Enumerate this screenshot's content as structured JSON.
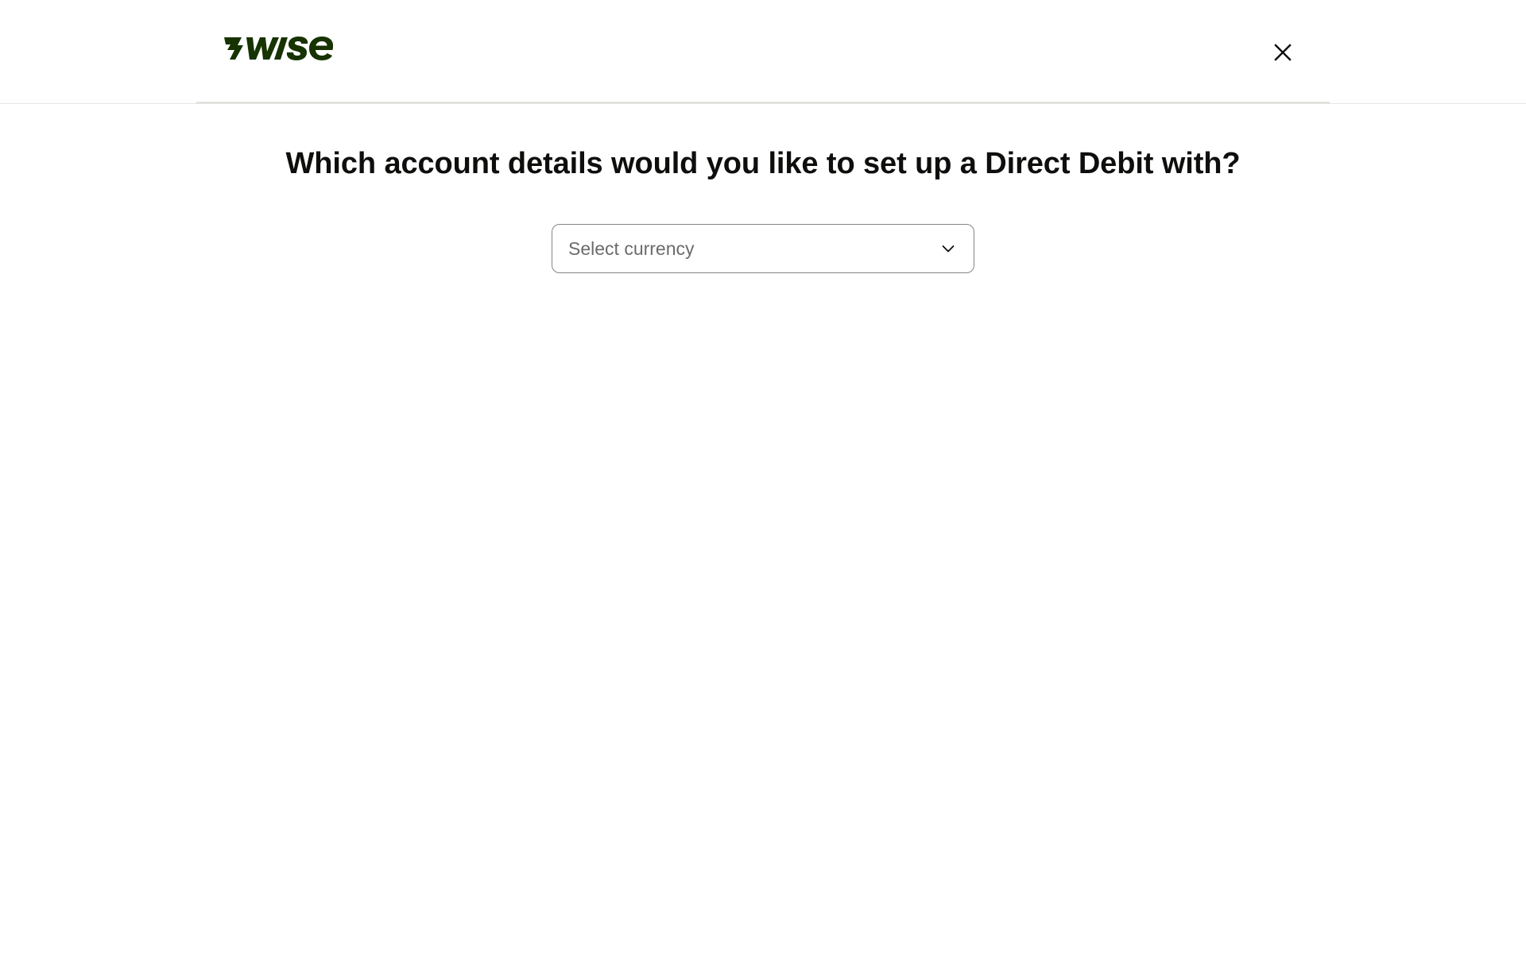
{
  "brand": {
    "name": "Wise",
    "logo_text": "7wise",
    "color": "#163300"
  },
  "header": {
    "close_icon": "close-icon"
  },
  "main": {
    "title": "Which account details would you like to set up a Direct Debit with?",
    "currency_select": {
      "placeholder": "Select currency",
      "value": "",
      "icon": "chevron-down-icon"
    }
  },
  "colors": {
    "text_primary": "#0e0f0c",
    "placeholder": "#6a6c6a",
    "border": "#868685",
    "divider": "#e2e3df"
  }
}
